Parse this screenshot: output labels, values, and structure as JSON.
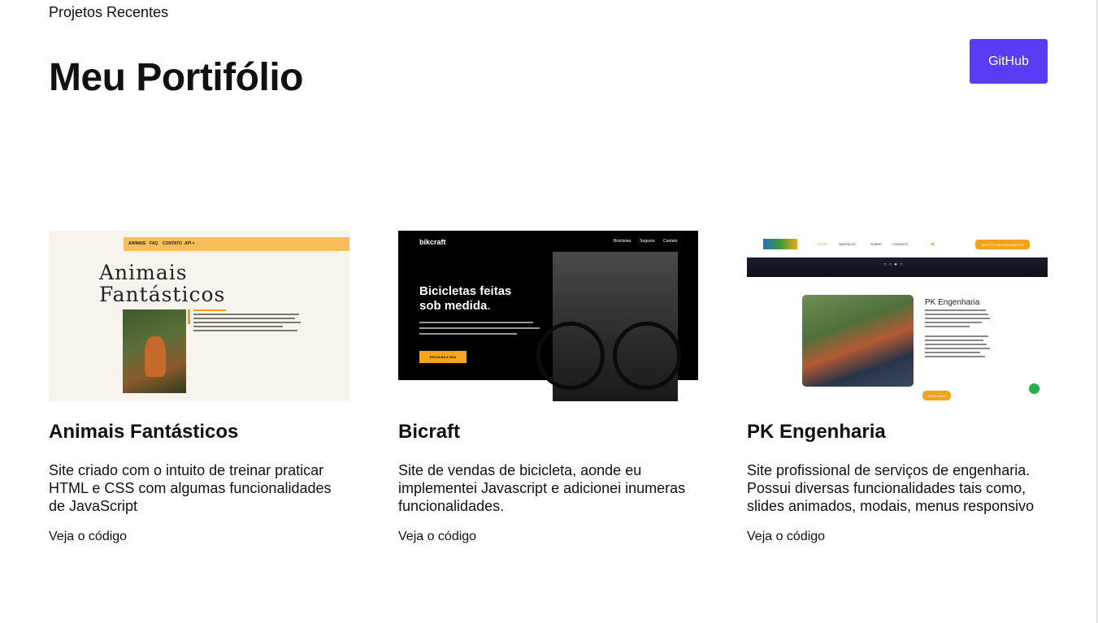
{
  "header": {
    "kicker": "Projetos Recentes",
    "title": "Meu Portifólio",
    "github_label": "GitHub"
  },
  "colors": {
    "accent": "#5b3cf5",
    "orange": "#f6a61a"
  },
  "projects": [
    {
      "title": "Animais Fantásticos",
      "description": "Site criado com o intuito de treinar praticar HTML e CSS com algumas funcionalidades de JavaScript",
      "link": "Veja o código",
      "thumb": {
        "heading_line1": "Animais",
        "heading_line2": "Fantásticos"
      }
    },
    {
      "title": "Bicraft",
      "description": "Site de vendas de bicicleta, aonde eu implementei Javascript e adicionei inumeras funcionalidades.",
      "link": "Veja o código",
      "thumb": {
        "logo": "bikcraft",
        "nav": [
          "Bicicletas",
          "Seguros",
          "Contato"
        ],
        "heading_line1": "Bicicletas feitas",
        "heading_line2": "sob medida",
        "button": "ESCOLHA A SUA"
      }
    },
    {
      "title": "PK Engenharia",
      "description": "Site profissional de serviços de engenharia. Possui diversas funcionalidades tais como, slides animados, modais, menus responsivo",
      "link": "Veja o código",
      "thumb": {
        "nav": [
          "HOME",
          "SERVIÇOS",
          "SOBRE",
          "CONTATO"
        ],
        "cta": "SOLICITE UM ORÇAMENTO",
        "heading": "PK Engenharia",
        "button": "SAIBA MAIS"
      }
    }
  ]
}
